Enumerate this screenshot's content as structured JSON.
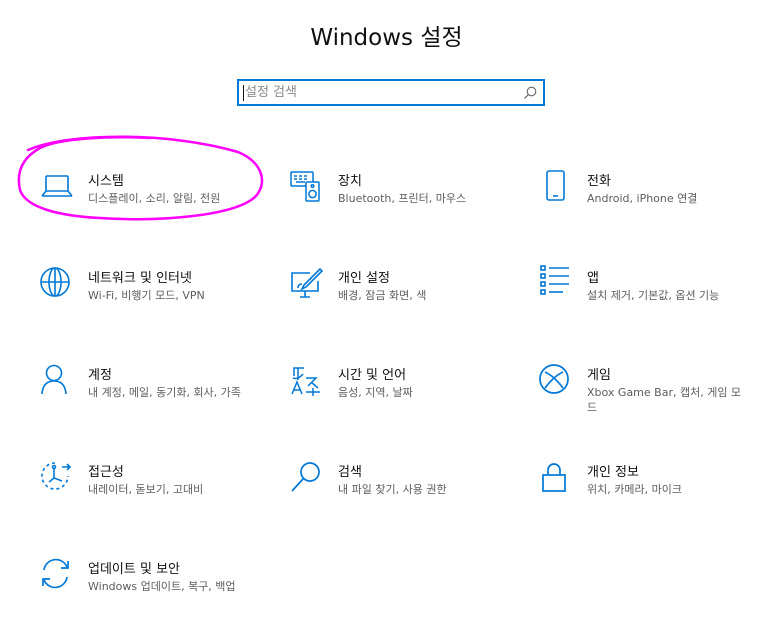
{
  "page": {
    "title": "Windows 설정"
  },
  "search": {
    "placeholder": "설정 검색",
    "value": ""
  },
  "tiles": [
    {
      "label": "시스템",
      "desc": "디스플레이, 소리, 알림, 전원",
      "icon": "laptop-icon"
    },
    {
      "label": "장치",
      "desc": "Bluetooth, 프린터, 마우스",
      "icon": "keyboard-speaker-icon"
    },
    {
      "label": "전화",
      "desc": "Android, iPhone 연결",
      "icon": "phone-icon"
    },
    {
      "label": "네트워크 및 인터넷",
      "desc": "Wi-Fi, 비행기 모드, VPN",
      "icon": "globe-icon"
    },
    {
      "label": "개인 설정",
      "desc": "배경, 잠금 화면, 색",
      "icon": "paint-monitor-icon"
    },
    {
      "label": "앱",
      "desc": "설치 제거, 기본값, 옵션 기능",
      "icon": "apps-list-icon"
    },
    {
      "label": "계정",
      "desc": "내 계정, 메일, 동기화, 회사, 가족",
      "icon": "person-icon"
    },
    {
      "label": "시간 및 언어",
      "desc": "음성, 지역, 날짜",
      "icon": "time-language-icon"
    },
    {
      "label": "게임",
      "desc": "Xbox Game Bar, 캡처, 게임 모드",
      "icon": "xbox-icon"
    },
    {
      "label": "접근성",
      "desc": "내레이터, 돋보기, 고대비",
      "icon": "ease-of-access-icon"
    },
    {
      "label": "검색",
      "desc": "내 파일 찾기, 사용 권한",
      "icon": "search-icon"
    },
    {
      "label": "개인 정보",
      "desc": "위치, 카메라, 마이크",
      "icon": "lock-icon"
    },
    {
      "label": "업데이트 및 보안",
      "desc": "Windows 업데이트, 복구, 백업",
      "icon": "sync-icon"
    }
  ],
  "colors": {
    "accent": "#0078d7",
    "annotation": "#ff00ff"
  }
}
